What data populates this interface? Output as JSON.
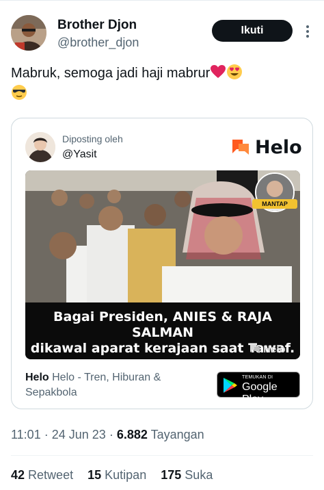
{
  "author": {
    "name": "Brother Djon",
    "handle": "@brother_djon",
    "follow_label": "Ikuti"
  },
  "tweet": {
    "text": "Mabruk, semoga jadi haji mabrur",
    "emojis": [
      "red-heart-emoji",
      "heart-eyes-emoji",
      "sunglasses-emoji"
    ]
  },
  "card": {
    "posted_by_label": "Diposting oleh",
    "poster": "@Yasit",
    "brand": "Helo",
    "video": {
      "caption_line1": "Bagai Presiden, ANIES & RAJA SALMAN",
      "caption_line2": "dikawal aparat kerajaan saat Tawaf.",
      "badge": "MANTAP",
      "watermark": "Helo"
    },
    "app_name": "Helo",
    "app_desc": "Helo - Tren, Hiburan & Sepakbola",
    "store_small": "TEMUKAN DI",
    "store_big": "Google Play"
  },
  "meta": {
    "time": "11:01",
    "date": "24 Jun 23",
    "views_count": "6.882",
    "views_label": "Tayangan"
  },
  "stats": {
    "retweets_count": "42",
    "retweets_label": "Retweet",
    "quotes_count": "15",
    "quotes_label": "Kutipan",
    "likes_count": "175",
    "likes_label": "Suka"
  },
  "colors": {
    "text_primary": "#0f1419",
    "text_secondary": "#536471",
    "border": "#cfd9de",
    "helo_orange": "#ff5a1f",
    "follow_bg": "#0f1419"
  }
}
